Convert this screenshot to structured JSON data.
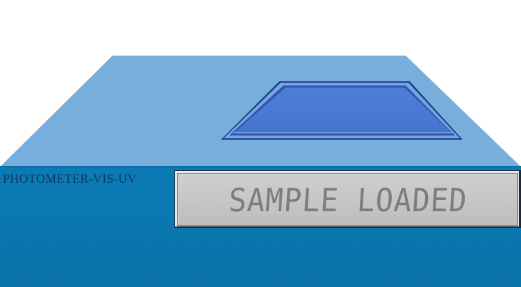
{
  "device": {
    "model_label": "PHOTOMETER-VIS-UV",
    "display_text": "SAMPLE LOADED",
    "colors": {
      "top_surface": "#78aedb",
      "front_face": "#0a78b1",
      "sample_lid": "#4a79d1",
      "display_bg": "#c6c6c6",
      "display_text": "#7d7d7d",
      "label_text": "#0b3a63"
    }
  }
}
